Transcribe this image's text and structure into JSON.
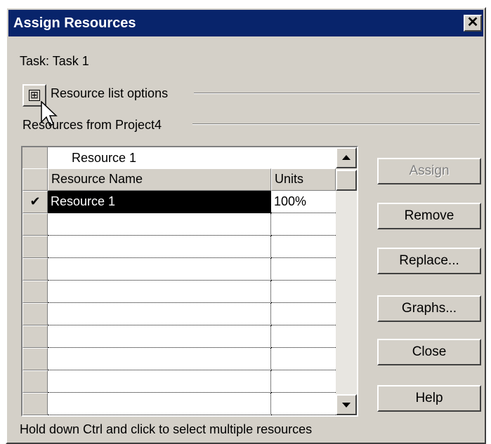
{
  "window": {
    "title": "Assign Resources",
    "close_glyph": "✕"
  },
  "task_label": "Task: Task 1",
  "options": {
    "label": "Resource list options",
    "toggle_glyph": "⊞"
  },
  "resources_from": "Resources from Project4",
  "grid": {
    "edit_value": "Resource 1",
    "columns": {
      "name": "Resource Name",
      "units": "Units"
    },
    "rows": [
      {
        "check": "✔",
        "name": "Resource 1",
        "units": "100%"
      },
      {
        "check": "",
        "name": "",
        "units": ""
      },
      {
        "check": "",
        "name": "",
        "units": ""
      },
      {
        "check": "",
        "name": "",
        "units": ""
      },
      {
        "check": "",
        "name": "",
        "units": ""
      },
      {
        "check": "",
        "name": "",
        "units": ""
      },
      {
        "check": "",
        "name": "",
        "units": ""
      },
      {
        "check": "",
        "name": "",
        "units": ""
      },
      {
        "check": "",
        "name": "",
        "units": ""
      },
      {
        "check": "",
        "name": "",
        "units": ""
      }
    ]
  },
  "buttons": {
    "assign": "Assign",
    "remove": "Remove",
    "replace": "Replace...",
    "graphs": "Graphs...",
    "close": "Close",
    "help": "Help"
  },
  "hint": "Hold down Ctrl and click to select multiple resources",
  "colors": {
    "titlebar": "#08246b",
    "face": "#d4d0c8",
    "selection": "#000000"
  }
}
